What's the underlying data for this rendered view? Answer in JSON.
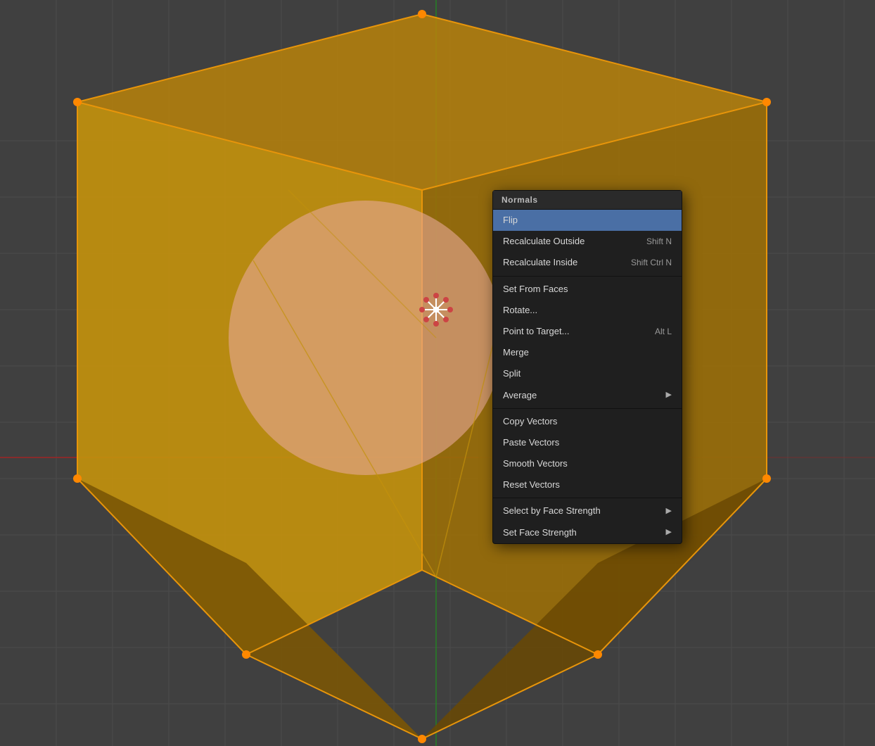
{
  "viewport": {
    "background_color": "#404040",
    "grid_color": "#4a4a4a"
  },
  "context_menu": {
    "title": "Normals",
    "items": [
      {
        "id": "flip",
        "label": "Flip",
        "shortcut": "",
        "has_arrow": false,
        "active": true,
        "separator_after": false
      },
      {
        "id": "recalculate-outside",
        "label": "Recalculate Outside",
        "shortcut": "Shift N",
        "has_arrow": false,
        "active": false,
        "separator_after": false
      },
      {
        "id": "recalculate-inside",
        "label": "Recalculate Inside",
        "shortcut": "Shift Ctrl N",
        "has_arrow": false,
        "active": false,
        "separator_after": true
      },
      {
        "id": "set-from-faces",
        "label": "Set From Faces",
        "shortcut": "",
        "has_arrow": false,
        "active": false,
        "separator_after": false
      },
      {
        "id": "rotate",
        "label": "Rotate...",
        "shortcut": "",
        "has_arrow": false,
        "active": false,
        "separator_after": false
      },
      {
        "id": "point-to-target",
        "label": "Point to Target...",
        "shortcut": "Alt L",
        "has_arrow": false,
        "active": false,
        "separator_after": false
      },
      {
        "id": "merge",
        "label": "Merge",
        "shortcut": "",
        "has_arrow": false,
        "active": false,
        "separator_after": false
      },
      {
        "id": "split",
        "label": "Split",
        "shortcut": "",
        "has_arrow": false,
        "active": false,
        "separator_after": false
      },
      {
        "id": "average",
        "label": "Average",
        "shortcut": "",
        "has_arrow": true,
        "active": false,
        "separator_after": true
      },
      {
        "id": "copy-vectors",
        "label": "Copy Vectors",
        "shortcut": "",
        "has_arrow": false,
        "active": false,
        "separator_after": false
      },
      {
        "id": "paste-vectors",
        "label": "Paste Vectors",
        "shortcut": "",
        "has_arrow": false,
        "active": false,
        "separator_after": false
      },
      {
        "id": "smooth-vectors",
        "label": "Smooth Vectors",
        "shortcut": "",
        "has_arrow": false,
        "active": false,
        "separator_after": false
      },
      {
        "id": "reset-vectors",
        "label": "Reset Vectors",
        "shortcut": "",
        "has_arrow": false,
        "active": false,
        "separator_after": true
      },
      {
        "id": "select-by-face-strength",
        "label": "Select by Face Strength",
        "shortcut": "",
        "has_arrow": true,
        "active": false,
        "separator_after": false
      },
      {
        "id": "set-face-strength",
        "label": "Set Face Strength",
        "shortcut": "",
        "has_arrow": true,
        "active": false,
        "separator_after": false
      }
    ]
  },
  "axis": {
    "x_color": "#cc3333",
    "y_color": "#33aa33",
    "z_color": "#3366cc"
  }
}
